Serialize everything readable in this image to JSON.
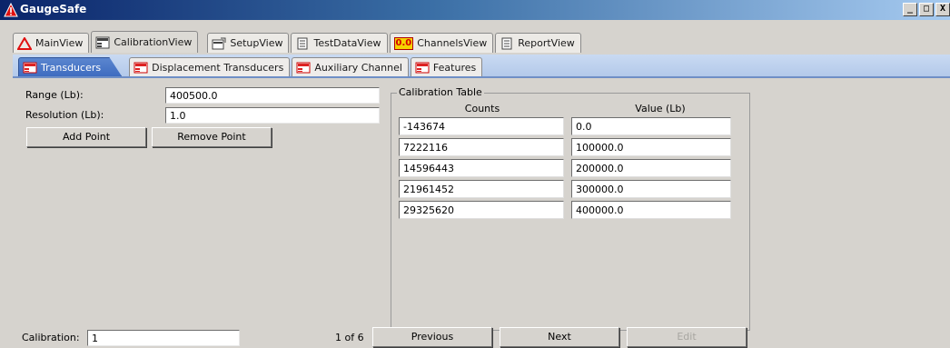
{
  "app": {
    "title": "GaugeSafe"
  },
  "window_buttons": {
    "minimize": "_",
    "maximize": "□",
    "close": "X"
  },
  "top_tabs": [
    {
      "label": "MainView",
      "icon": "warning-triangle-icon"
    },
    {
      "label": "CalibrationView",
      "icon": "transducer-icon",
      "active": true
    },
    {
      "label": "SetupView",
      "icon": "setup-icon"
    },
    {
      "label": "TestDataView",
      "icon": "document-icon"
    },
    {
      "label": "ChannelsView",
      "icon": "channels-icon",
      "icon_text": "0.0"
    },
    {
      "label": "ReportView",
      "icon": "report-icon"
    }
  ],
  "sub_tabs": [
    {
      "label": "Transducers",
      "active": true
    },
    {
      "label": "Displacement Transducers"
    },
    {
      "label": "Auxiliary Channel"
    },
    {
      "label": "Features"
    }
  ],
  "form": {
    "range_label": "Range (Lb):",
    "range_value": "400500.0",
    "resolution_label": "Resolution (Lb):",
    "resolution_value": "1.0",
    "add_point": "Add Point",
    "remove_point": "Remove Point"
  },
  "calibration_table": {
    "title": "Calibration Table",
    "columns": [
      "Counts",
      "Value (Lb)"
    ],
    "rows": [
      [
        "-143674",
        "0.0"
      ],
      [
        "7222116",
        "100000.0"
      ],
      [
        "14596443",
        "200000.0"
      ],
      [
        "21961452",
        "300000.0"
      ],
      [
        "29325620",
        "400000.0"
      ]
    ]
  },
  "footer": {
    "calibration_label": "Calibration:",
    "calibration_value": "1",
    "page_indicator": "1 of 6",
    "previous": "Previous",
    "next": "Next",
    "edit": "Edit"
  },
  "colors": {
    "title_bar": "#0a246a",
    "active_subtab": "#3e6cc0",
    "window_bg": "#d6d3ce",
    "accent_red": "#e01010"
  }
}
